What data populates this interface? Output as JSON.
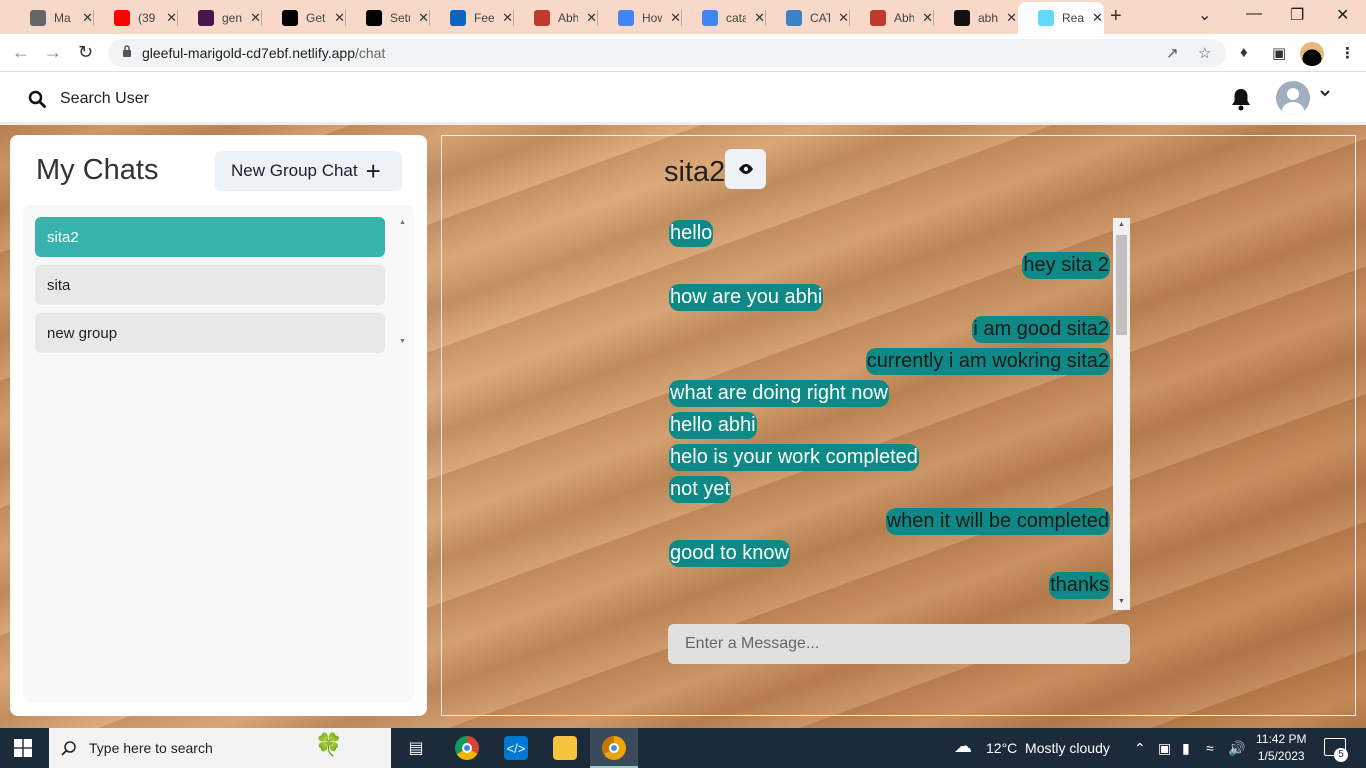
{
  "browser": {
    "tabs": [
      {
        "title": "Ma",
        "icon": "maps-icon",
        "color": "#666"
      },
      {
        "title": "(39",
        "icon": "youtube-icon",
        "color": "#ff0000"
      },
      {
        "title": "gen",
        "icon": "slack-icon",
        "color": "#4a154b"
      },
      {
        "title": "Get",
        "icon": "nextjs-icon",
        "color": "#000000"
      },
      {
        "title": "Setu",
        "icon": "nextjs-icon",
        "color": "#000000"
      },
      {
        "title": "Fee",
        "icon": "linkedin-icon",
        "color": "#0a66c2"
      },
      {
        "title": "Abh",
        "icon": "avatar-icon",
        "color": "#c0392b"
      },
      {
        "title": "How",
        "icon": "google-icon",
        "color": "#4285f4"
      },
      {
        "title": "cata",
        "icon": "google-icon",
        "color": "#4285f4"
      },
      {
        "title": "CAT",
        "icon": "gear-icon",
        "color": "#3b82c4"
      },
      {
        "title": "Abh",
        "icon": "avatar-icon",
        "color": "#c0392b"
      },
      {
        "title": "abh",
        "icon": "github-icon",
        "color": "#111111"
      },
      {
        "title": "Rea",
        "icon": "react-icon",
        "color": "#61dafb"
      }
    ],
    "url_host": "gleeful-marigold-cd7ebf.netlify.app",
    "url_path": "/chat"
  },
  "header": {
    "search_label": "Search User"
  },
  "sidebar": {
    "title": "My Chats",
    "new_group_label": "New Group Chat",
    "chats": [
      "sita2",
      "sita",
      "new group"
    ],
    "selected_index": 0
  },
  "chat": {
    "name": "sita2",
    "messages": [
      {
        "text": "hello",
        "mine": true
      },
      {
        "text": "hey sita 2",
        "mine": false
      },
      {
        "text": "how are you abhi",
        "mine": true
      },
      {
        "text": "i am good sita2",
        "mine": false
      },
      {
        "text": "currently i am wokring sita2",
        "mine": false
      },
      {
        "text": "what are doing right now",
        "mine": true
      },
      {
        "text": "hello abhi",
        "mine": true
      },
      {
        "text": "helo is your work completed",
        "mine": true
      },
      {
        "text": "not yet",
        "mine": true
      },
      {
        "text": "when it will be completed",
        "mine": false
      },
      {
        "text": "good to know",
        "mine": true
      },
      {
        "text": "thanks",
        "mine": false
      }
    ],
    "input_placeholder": "Enter a Message..."
  },
  "taskbar": {
    "search_placeholder": "Type here to search",
    "weather": "12°C  Mostly cloudy",
    "time": "11:42 PM",
    "date": "1/5/2023",
    "notification_count": "5"
  },
  "colors": {
    "accent": "#38b2ac",
    "bubble": "#0d8a86"
  }
}
